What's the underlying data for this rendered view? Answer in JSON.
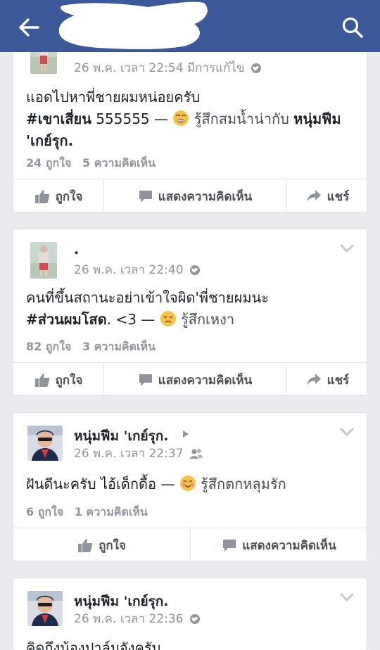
{
  "posts": [
    {
      "author": "",
      "time": "26 พ.ค. เวลา 22:54 มีการแก้ไข",
      "text_a": "แอดไปหาพี่ชายผมหน่อยครับ",
      "hashtag": "#เขาเสี่ยน",
      "text_b": " 555555 — ",
      "feeling": "รู้สึกสมน้ำน่ากับ ",
      "tagged": "หนุ่มฟีม 'เกย์รุก.",
      "likes": "24 ถูกใจ",
      "comments": "5 ความคิดเห็น"
    },
    {
      "author": ".",
      "time": "26 พ.ค. เวลา 22:40",
      "text_a": "คนที่ขึ้นสถานะอย่าเข้าใจผิด'พี่ชายผมนะ",
      "hashtag": "#ส่วนผมโสด",
      "text_b": ". <3 — ",
      "feeling": "รู้สึกเหงา",
      "likes": "82 ถูกใจ",
      "comments": "3 ความคิดเห็น"
    },
    {
      "author": "หนุ่มฟีม 'เกย์รุก.",
      "time": "26 พ.ค. เวลา 22:37",
      "text_a": "ฝันดีนะครับ ไอ้เด็กดื้อ — ",
      "feeling": "รู้สึกตกหลุมรัก",
      "likes": "6 ถูกใจ",
      "comments": "1 ความคิดเห็น"
    },
    {
      "author": "หนุ่มฟีม 'เกย์รุก.",
      "time": "26 พ.ค. เวลา 22:36",
      "text_a": "คิดถึงน้องปาล์มจังครับ"
    }
  ],
  "actions": {
    "like": "ถูกใจ",
    "comment": "แสดงความคิดเห็น",
    "share": "แชร์"
  },
  "colors": {
    "topbar": "#3b5998",
    "meta": "#90949c",
    "text": "#1d2129"
  }
}
